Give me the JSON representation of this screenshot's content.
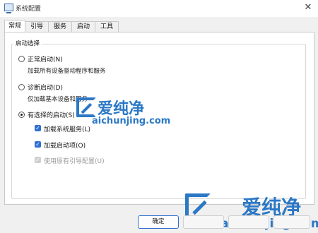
{
  "window": {
    "title": "系统配置",
    "close_glyph": "✕"
  },
  "tabs": [
    {
      "label": "常规",
      "active": true
    },
    {
      "label": "引导",
      "active": false
    },
    {
      "label": "服务",
      "active": false
    },
    {
      "label": "启动",
      "active": false
    },
    {
      "label": "工具",
      "active": false
    }
  ],
  "startup_group": {
    "label": "启动选择",
    "options": [
      {
        "label": "正常启动(N)",
        "description": "加载所有设备驱动程序和服务",
        "checked": false
      },
      {
        "label": "诊断启动(D)",
        "description": "仅加载基本设备和服务",
        "checked": false
      },
      {
        "label": "有选择的启动(S)",
        "checked": true
      }
    ],
    "checkboxes": [
      {
        "label": "加载系统服务(L)",
        "checked": true,
        "enabled": true
      },
      {
        "label": "加载启动项(O)",
        "checked": true,
        "enabled": true
      },
      {
        "label": "使用原有引导配置(U)",
        "checked": true,
        "enabled": false
      }
    ]
  },
  "buttons": {
    "ok": "确定"
  },
  "watermark": {
    "cn": "爱纯净",
    "url": "aichunjing.com",
    "color": "#2b78c6"
  }
}
